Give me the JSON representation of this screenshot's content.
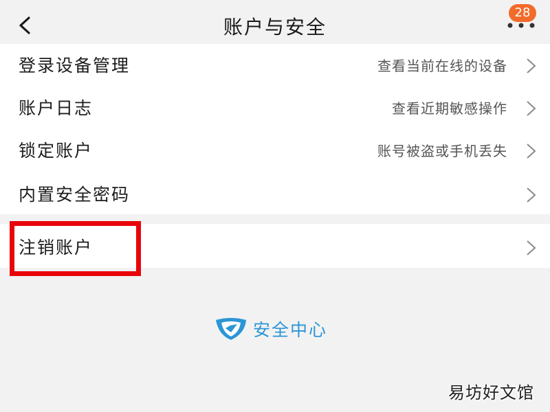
{
  "header": {
    "title": "账户与安全",
    "badge_count": "28"
  },
  "settings": {
    "items": [
      {
        "label": "登录设备管理",
        "hint": "查看当前在线的设备"
      },
      {
        "label": "账户日志",
        "hint": "查看近期敏感操作"
      },
      {
        "label": "锁定账户",
        "hint": "账号被盗或手机丢失"
      },
      {
        "label": "内置安全密码",
        "hint": ""
      }
    ],
    "deactivate": {
      "label": "注销账户"
    }
  },
  "footer": {
    "logo_text": "安全中心"
  },
  "watermark": {
    "text": "易坊好文馆"
  },
  "colors": {
    "badge": "#f26b2a",
    "highlight_border": "#e8050a",
    "brand_blue": "#2b95d6"
  },
  "icons": {
    "back": "back-arrow-icon",
    "more": "more-dots-icon",
    "chevron": "chevron-right-icon",
    "logo": "shield-icon"
  }
}
